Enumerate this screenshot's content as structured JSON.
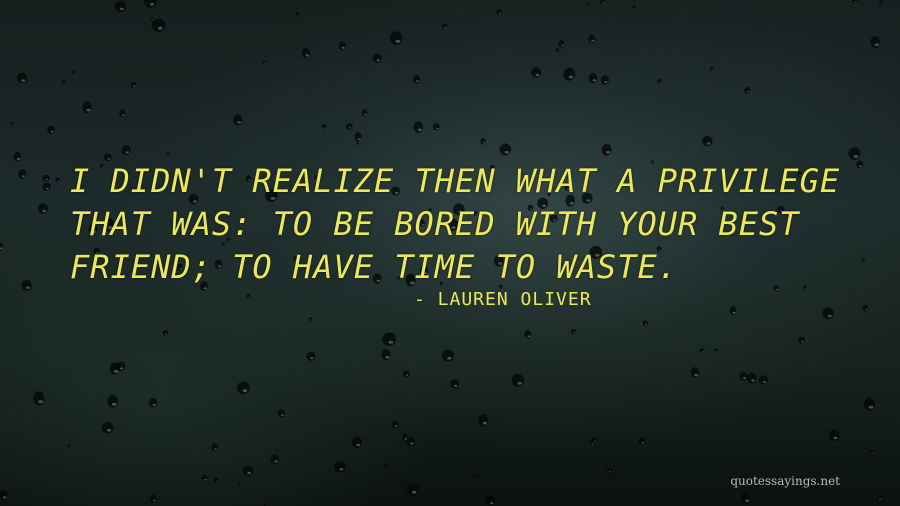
{
  "quote": {
    "text": "I didn't realize then what a privilege that was: to be bored with your best friend; to have time to waste.",
    "author": "- Lauren Oliver"
  },
  "watermark": {
    "site": "quotessayings.net"
  },
  "background": {
    "description_icon": "raindrops-on-glass",
    "base_color": "#0c1614"
  },
  "colors": {
    "text": "#ece85c"
  }
}
